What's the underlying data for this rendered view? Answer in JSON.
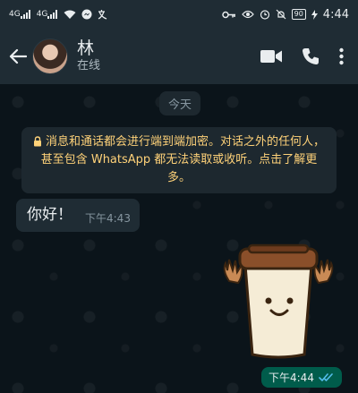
{
  "status_bar": {
    "signal1": "4G",
    "signal2": "4G",
    "battery": "90",
    "time": "4:44"
  },
  "header": {
    "contact_name": "林",
    "contact_status": "在线"
  },
  "chat": {
    "date_chip": "今天",
    "encryption_notice": "消息和通话都会进行端到端加密。对话之外的任何人，甚至包含 WhatsApp 都无法读取或收听。点击了解更多。",
    "messages": [
      {
        "direction": "in",
        "text": "你好！",
        "time": "下午4:43"
      }
    ],
    "sticker_message": {
      "direction": "out",
      "time": "下午4:44",
      "read": true
    }
  },
  "colors": {
    "header_bg": "#1f2c34",
    "chat_bg": "#0b141a",
    "notice_text": "#ffd279",
    "outgoing_bubble": "#005c4b",
    "read_ticks": "#53bdeb"
  }
}
